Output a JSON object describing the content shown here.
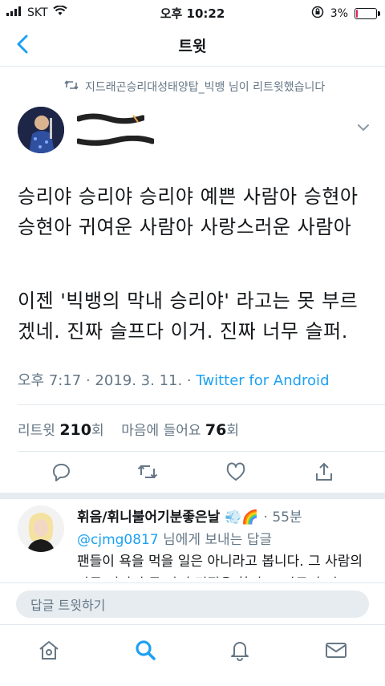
{
  "status_bar": {
    "carrier": "SKT",
    "time": "오후 10:22",
    "battery_percent": "3%",
    "battery_level": 0.03
  },
  "nav": {
    "title": "트윗"
  },
  "tweet": {
    "retweeted_by": "지드래곤승리대성태양탑_빅뱅 님이 리트윗했습니다",
    "text_p1": "승리야 승리야 승리야 예쁜 사람아 승현아 승현아 귀여운 사람아 사랑스러운 사람아",
    "text_p2": "이젠 '빅뱅의 막내 승리야' 라고는 못 부르겠네. 진짜 슬프다 이거. 진짜 너무 슬퍼.",
    "timestamp": "오후 7:17 · 2019. 3. 11. · ",
    "source": "Twitter for Android",
    "retweet_label": "리트윗",
    "retweet_count": "210",
    "retweet_unit": "회",
    "like_label": "마음에 들어요",
    "like_count": "76",
    "like_unit": "회"
  },
  "reply": {
    "name": "휘음/휘니불어기분좋은날 💨🌈",
    "time": "· 55분",
    "reply_to_mention": "@cjmg0817",
    "reply_to_suffix": " 님에게 보내는 답글",
    "body": "팬들이 욕을 먹을 일은 아니라고 봅니다. 그 사람의 다른 면까지 못 봐서 덕질을 한거고, 아무리 이"
  },
  "composer": {
    "placeholder": "답글 트윗하기"
  },
  "colors": {
    "accent": "#1da1f2",
    "muted": "#657786",
    "text": "#14171a"
  },
  "icons": [
    "back-chevron-icon",
    "retweet-icon",
    "caret-down-icon",
    "reply-icon",
    "like-icon",
    "share-icon",
    "home-icon",
    "search-icon",
    "notifications-icon",
    "messages-icon"
  ]
}
